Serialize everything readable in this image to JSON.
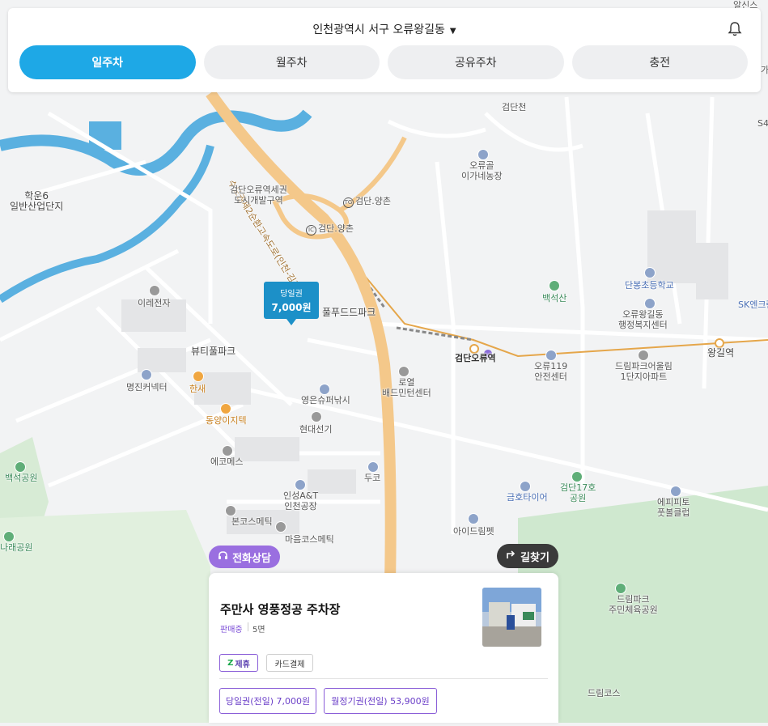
{
  "header": {
    "location": "인천광역시 서구 오류왕길동",
    "tabs": [
      {
        "label": "일주차",
        "active": true
      },
      {
        "label": "월주차",
        "active": false
      },
      {
        "label": "공유주차",
        "active": false
      },
      {
        "label": "충전",
        "active": false
      }
    ]
  },
  "map": {
    "labels": {
      "hakun": "학운6\n일반산업단지",
      "highway": "수도권제2순환고속도로(인천-김포)",
      "dev_zone": "검단오류역세권\n도시개발구역",
      "ic1": "검단.양촌",
      "ic2": "검단.양촌",
      "ic1_badge": "TG",
      "ic2_badge": "IC",
      "oryugol": "오류골\n이가네농장",
      "geomdancheon": "검단천",
      "irae": "이레전자",
      "beauty": "뷰티풀파크",
      "food": "풀푸드드파크",
      "myungjin": "명진커넥터",
      "hansae": "한새",
      "dongyang": "동양이지텍",
      "royal": "로열\n배드민턴센터",
      "youngeun": "영은슈퍼낚시",
      "hyundai": "현대선기",
      "ecomes": "에코메스",
      "duco": "두코",
      "baekseok": "백석공원",
      "insung": "인성A&T\n인천공장",
      "bon": "본코스메틱",
      "maeul": "마음코스메틱",
      "nara": "나래공원",
      "baekseoksan": "백석산",
      "danbong": "단봉초등학교",
      "welfare": "오류왕길동\n행정복지센터",
      "geomdan_station": "검단오류역",
      "safety": "오류119\n안전센터",
      "dream_apt": "드림파크어울림\n1단지아파트",
      "wanggil": "왕길역",
      "sk": "SK엔크린",
      "park17": "검단17호\n공원",
      "kumho": "금호타이어",
      "epip": "에피피토\n풋볼클럽",
      "eyedream": "아이드림펫",
      "dreampark_gym": "드림파크\n주민체육공원",
      "dreamcourse": "드림코스",
      "altsin": "알신스",
      "ka": "가",
      "s4": "S4"
    }
  },
  "marker": {
    "label": "당일권",
    "price": "7,000원"
  },
  "buttons": {
    "consult": "전화상담",
    "route": "길찾기"
  },
  "card": {
    "name": "주만사 영풍정공 주차장",
    "status": "판매중",
    "spaces": "5면",
    "tags": [
      "제휴",
      "카드결제"
    ],
    "prices": [
      "당일권(전일) 7,000원",
      "월정기권(전일) 53,900원"
    ]
  },
  "colors": {
    "accent": "#1ea8e6",
    "purple": "#9a6fe0",
    "marker": "#1c90c8",
    "river": "#5ab0e0",
    "highway": "#f4c88a"
  }
}
